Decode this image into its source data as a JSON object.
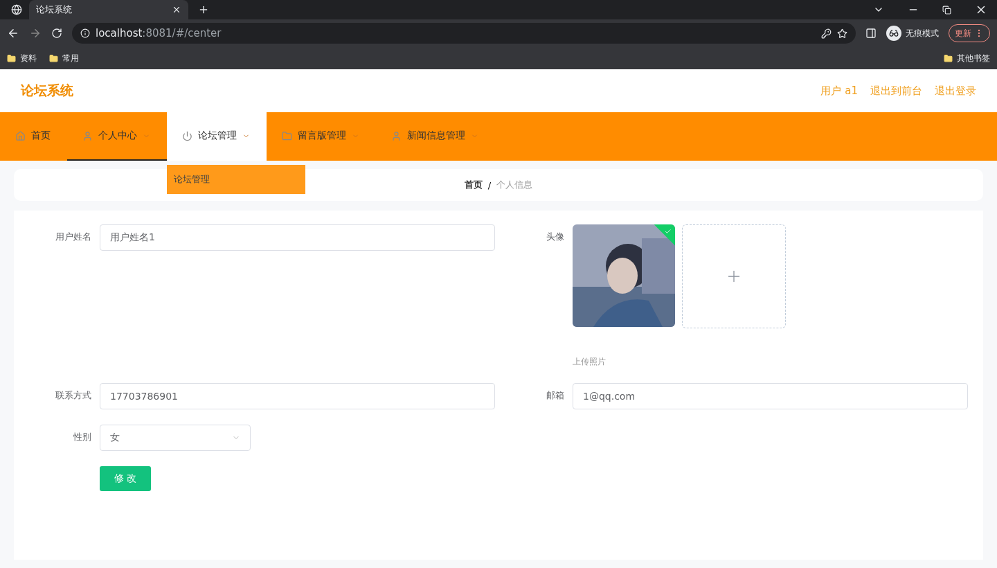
{
  "browser": {
    "tab_title": "论坛系统",
    "url_host": "localhost",
    "url_path": ":8081/#/center",
    "incognito_label": "无痕模式",
    "update_button": "更新",
    "bookmarks": [
      "资料",
      "常用"
    ],
    "other_bookmarks": "其他书签"
  },
  "header": {
    "title": "论坛系统",
    "links": [
      "用户 a1",
      "退出到前台",
      "退出登录"
    ]
  },
  "nav": [
    {
      "label": "首页",
      "kind": "link",
      "selected": false,
      "expanded": false
    },
    {
      "label": "个人中心",
      "kind": "dropdown",
      "selected": true,
      "expanded": false
    },
    {
      "label": "论坛管理",
      "kind": "dropdown",
      "selected": false,
      "expanded": true,
      "menu": [
        "论坛管理"
      ]
    },
    {
      "label": "留言版管理",
      "kind": "dropdown",
      "selected": false,
      "expanded": false
    },
    {
      "label": "新闻信息管理",
      "kind": "dropdown",
      "selected": false,
      "expanded": false
    }
  ],
  "breadcrumb": {
    "items": [
      "首页",
      "个人信息"
    ],
    "separator": "/"
  },
  "form": {
    "username": {
      "label": "用户姓名",
      "value": "用户姓名1"
    },
    "avatar": {
      "label": "头像",
      "uploaded": true,
      "hint": "上传照片"
    },
    "phone": {
      "label": "联系方式",
      "value": "17703786901"
    },
    "email": {
      "label": "邮箱",
      "value": "1@qq.com"
    },
    "gender": {
      "label": "性别",
      "value": "女"
    },
    "submit": "修 改"
  }
}
